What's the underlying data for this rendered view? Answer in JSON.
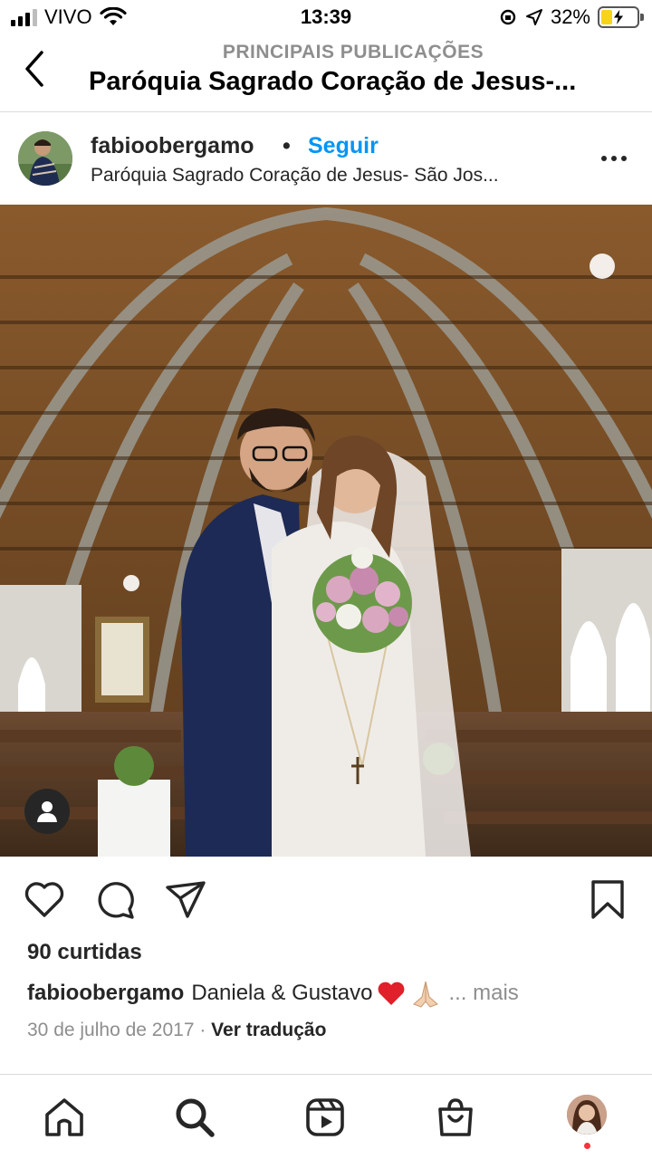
{
  "status_bar": {
    "carrier": "VIVO",
    "time": "13:39",
    "battery_percent": "32%",
    "battery_level": 0.32
  },
  "header": {
    "subtitle": "PRINCIPAIS PUBLICAÇÕES",
    "title": "Paróquia Sagrado Coração de Jesus-..."
  },
  "post": {
    "username": "fabioobergamo",
    "separator": "•",
    "follow_label": "Seguir",
    "location": "Paróquia Sagrado Coração de Jesus- São Jos...",
    "likes": "90 curtidas",
    "caption_user": "fabioobergamo",
    "caption_text": "Daniela & Gustavo",
    "caption_more": "... mais",
    "date": "30 de julho de 2017",
    "date_separator": " · ",
    "translate_label": "Ver tradução"
  },
  "icons": {
    "back": "chevron-left-icon",
    "more": "more-horizontal-icon",
    "like": "heart-icon",
    "comment": "comment-icon",
    "share": "paper-plane-icon",
    "save": "bookmark-icon",
    "home": "home-icon",
    "search": "search-icon",
    "reels": "reels-icon",
    "shop": "shop-bag-icon"
  },
  "colors": {
    "accent": "#0095f6",
    "text": "#262626",
    "muted": "#8e8e8e",
    "notification": "#ff3040"
  }
}
